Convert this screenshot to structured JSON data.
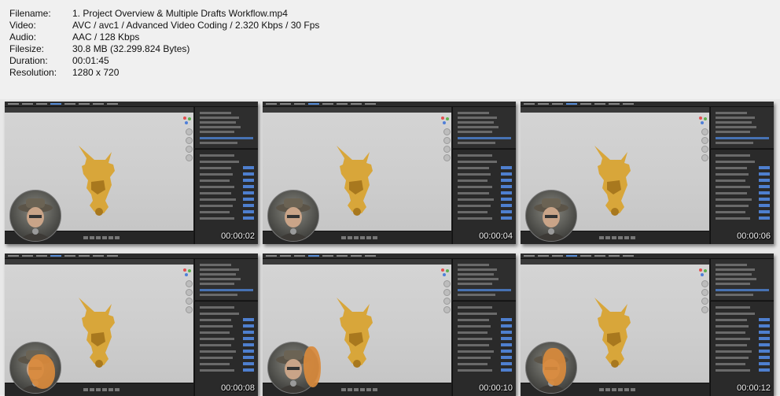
{
  "info": {
    "rows": [
      {
        "label": "Filename:",
        "value": "1. Project Overview & Multiple Drafts Workflow.mp4"
      },
      {
        "label": "Video:",
        "value": "AVC / avc1 / Advanced Video Coding / 2.320 Kbps / 30 Fps"
      },
      {
        "label": "Audio:",
        "value": "AAC / 128 Kbps"
      },
      {
        "label": "Filesize:",
        "value": "30.8 MB (32.299.824 Bytes)"
      },
      {
        "label": "Duration:",
        "value": "00:01:45"
      },
      {
        "label": "Resolution:",
        "value": "1280 x 720"
      }
    ]
  },
  "thumbnails": [
    {
      "timestamp": "00:00:02",
      "hand": false
    },
    {
      "timestamp": "00:00:04",
      "hand": false
    },
    {
      "timestamp": "00:00:06",
      "hand": false
    },
    {
      "timestamp": "00:00:08",
      "hand": true
    },
    {
      "timestamp": "00:00:10",
      "hand": true
    },
    {
      "timestamp": "00:00:12",
      "hand": true
    }
  ],
  "colors": {
    "model": "#d8a63a",
    "model_shadow": "#a8781e",
    "selection": "#4772b3",
    "background": "#f0f0f0"
  },
  "icons": {
    "model": "3d-model-icon",
    "webcam": "webcam-overlay-icon",
    "gizmo": "axis-gizmo-icon"
  }
}
